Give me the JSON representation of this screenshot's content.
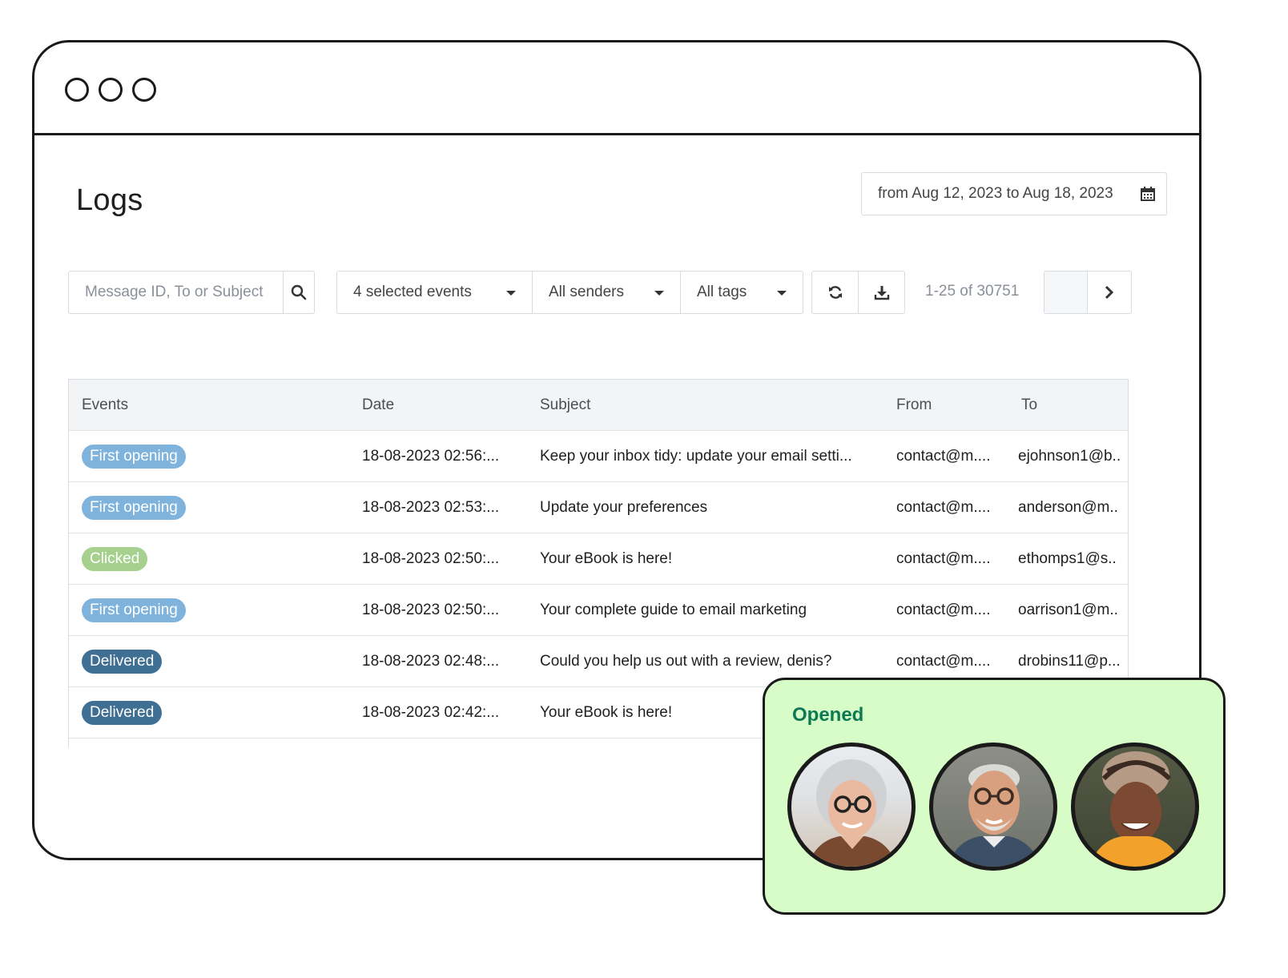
{
  "window": {
    "controls": [
      "dot-1",
      "dot-2",
      "dot-3"
    ]
  },
  "header": {
    "title": "Logs",
    "date_range": "from Aug 12, 2023 to Aug 18, 2023",
    "date_range_icon": "calendar-icon"
  },
  "toolbar": {
    "search_placeholder": "Message ID, To or Subject",
    "search_icon": "search-icon",
    "events_filter": "4 selected events",
    "senders_filter": "All senders",
    "tags_filter": "All tags",
    "refresh_icon": "refresh-icon",
    "download_icon": "download-icon",
    "pager_text": "1-25 of 30751",
    "next_icon": "chevron-right-icon"
  },
  "table": {
    "headers": {
      "events": "Events",
      "date": "Date",
      "subject": "Subject",
      "from": "From",
      "to": "To"
    },
    "rows": [
      {
        "event": "First opening",
        "event_color": "#7fb3dc",
        "date": "18-08-2023 02:56:...",
        "subject": "Keep your inbox tidy: update your email setti...",
        "from": "contact@m....",
        "to": "ejohnson1@b.."
      },
      {
        "event": "First opening",
        "event_color": "#7fb3dc",
        "date": "18-08-2023 02:53:...",
        "subject": "Update your preferences",
        "from": "contact@m....",
        "to": "anderson@m.."
      },
      {
        "event": "Clicked",
        "event_color": "#a6d08e",
        "date": "18-08-2023 02:50:...",
        "subject": "Your eBook is here!",
        "from": "contact@m....",
        "to": "ethomps1@s.."
      },
      {
        "event": "First opening",
        "event_color": "#7fb3dc",
        "date": "18-08-2023 02:50:...",
        "subject": "Your complete guide to email marketing",
        "from": "contact@m....",
        "to": "oarrison1@m.."
      },
      {
        "event": "Delivered",
        "event_color": "#3f6f93",
        "date": "18-08-2023 02:48:...",
        "subject": "Could you help us out with a review, denis?",
        "from": "contact@m....",
        "to": "drobins11@p..."
      },
      {
        "event": "Delivered",
        "event_color": "#3f6f93",
        "date": "18-08-2023 02:42:...",
        "subject": "Your eBook is here!",
        "from": "",
        "to": ""
      }
    ]
  },
  "opened_card": {
    "title": "Opened",
    "avatars": [
      "avatar-woman-glasses",
      "avatar-man-glasses",
      "avatar-woman-headwrap"
    ]
  }
}
